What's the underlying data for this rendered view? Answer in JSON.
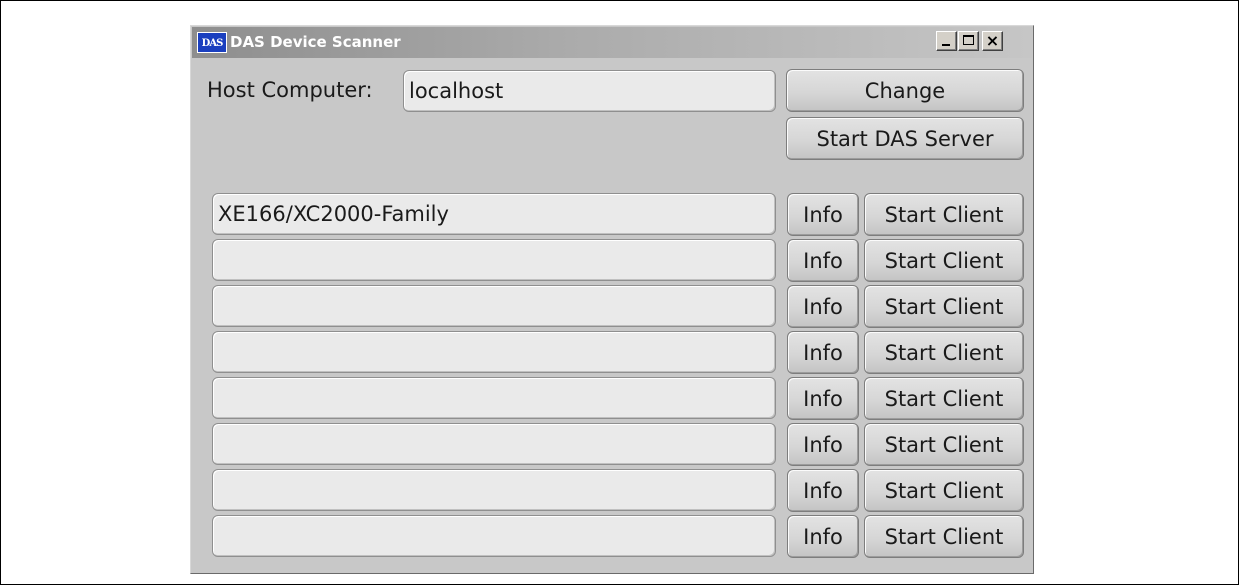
{
  "window": {
    "title": "DAS Device Scanner",
    "icon_text": "DAS",
    "close_glyph": "×"
  },
  "host": {
    "label": "Host Computer:",
    "value": "localhost",
    "change_label": "Change",
    "start_server_label": "Start DAS Server"
  },
  "devices": [
    {
      "name": "XE166/XC2000-Family",
      "info_label": "Info",
      "client_label": "Start Client"
    },
    {
      "name": "",
      "info_label": "Info",
      "client_label": "Start Client"
    },
    {
      "name": "",
      "info_label": "Info",
      "client_label": "Start Client"
    },
    {
      "name": "",
      "info_label": "Info",
      "client_label": "Start Client"
    },
    {
      "name": "",
      "info_label": "Info",
      "client_label": "Start Client"
    },
    {
      "name": "",
      "info_label": "Info",
      "client_label": "Start Client"
    },
    {
      "name": "",
      "info_label": "Info",
      "client_label": "Start Client"
    },
    {
      "name": "",
      "info_label": "Info",
      "client_label": "Start Client"
    }
  ]
}
